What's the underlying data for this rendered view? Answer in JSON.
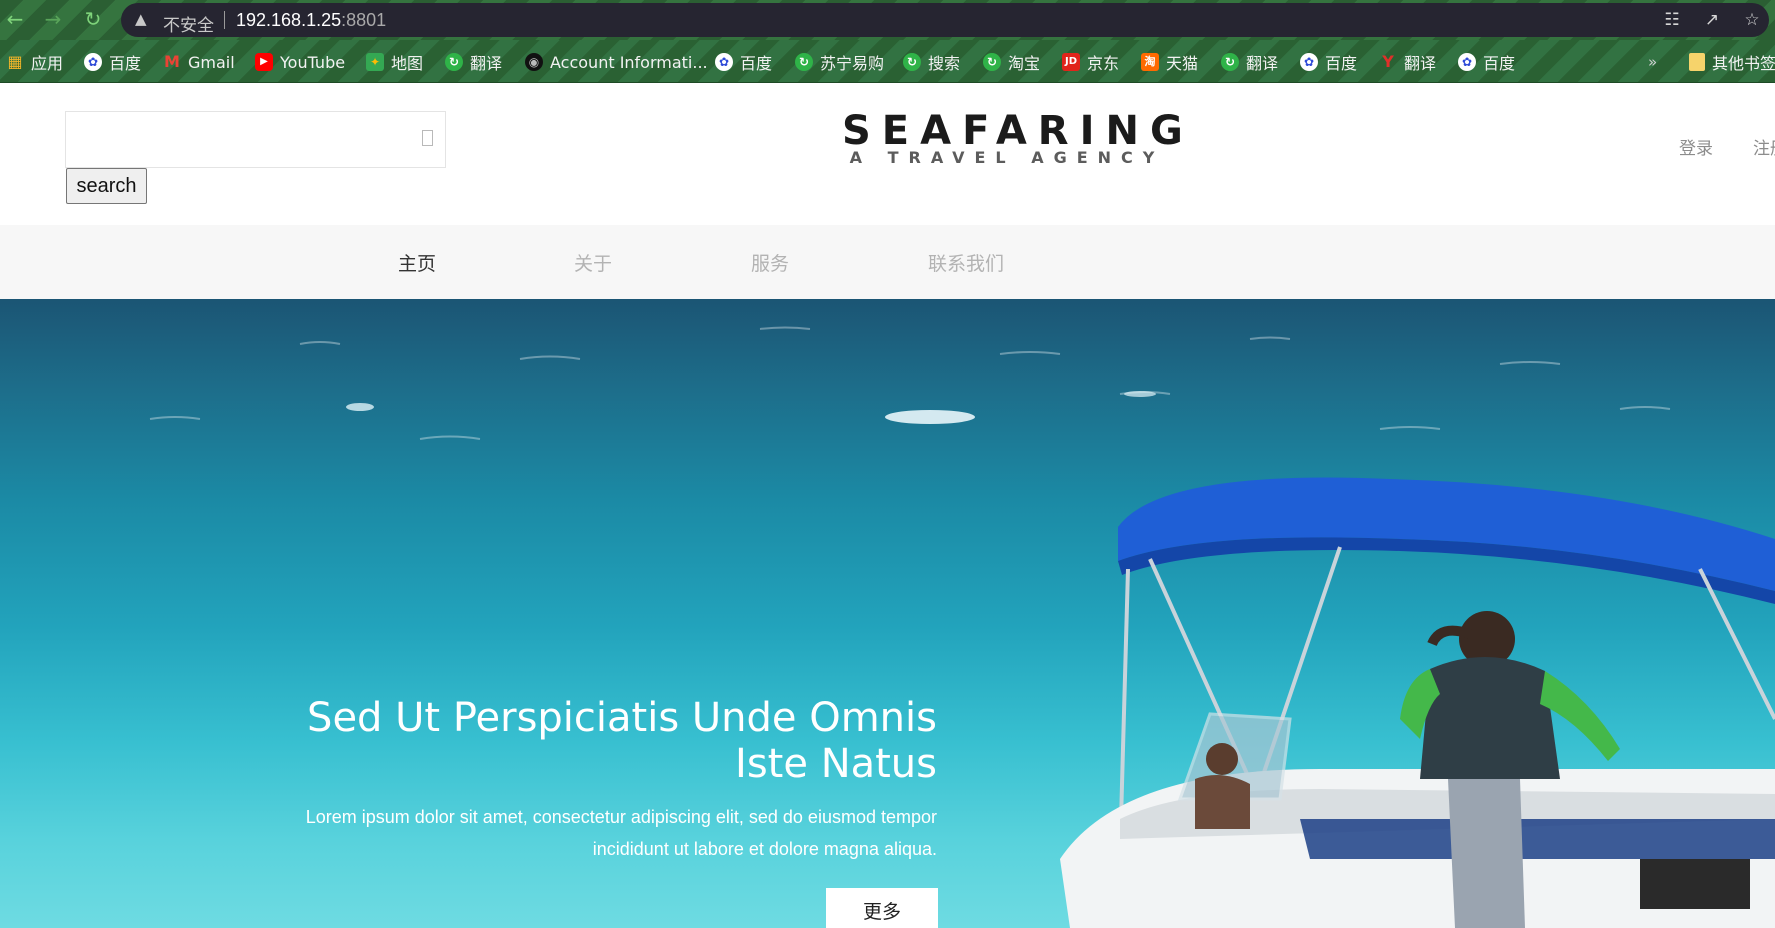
{
  "browser": {
    "security_label": "不安全",
    "url_host": "192.168.1.25",
    "url_port": ":8801",
    "bookmarks": [
      {
        "label": "应用",
        "icon": "apps-grid-icon"
      },
      {
        "label": "百度",
        "icon": "baidu-icon"
      },
      {
        "label": "Gmail",
        "icon": "gmail-icon"
      },
      {
        "label": "YouTube",
        "icon": "youtube-icon"
      },
      {
        "label": "地图",
        "icon": "maps-icon"
      },
      {
        "label": "翻译",
        "icon": "translate-icon"
      },
      {
        "label": "Account Informati...",
        "icon": "account-icon"
      },
      {
        "label": "百度",
        "icon": "baidu-icon"
      },
      {
        "label": "苏宁易购",
        "icon": "suning-icon"
      },
      {
        "label": "搜索",
        "icon": "search-bookmark-icon"
      },
      {
        "label": "淘宝",
        "icon": "taobao-icon"
      },
      {
        "label": "京东",
        "icon": "jd-icon"
      },
      {
        "label": "天猫",
        "icon": "tmall-icon"
      },
      {
        "label": "翻译",
        "icon": "translate-icon"
      },
      {
        "label": "百度",
        "icon": "baidu-icon"
      },
      {
        "label": "翻译",
        "icon": "youdao-icon"
      },
      {
        "label": "百度",
        "icon": "baidu-icon"
      }
    ],
    "more_bookmarks": "»",
    "other_bookmarks": "其他书签"
  },
  "header": {
    "search_placeholder": "",
    "search_button": "search",
    "logo_title": "SEAFARING",
    "logo_subtitle": "A TRAVEL AGENCY",
    "login": "登录",
    "register": "注册"
  },
  "nav": {
    "items": [
      {
        "label": "主页"
      },
      {
        "label": "关于"
      },
      {
        "label": "服务"
      },
      {
        "label": "联系我们"
      }
    ]
  },
  "hero": {
    "title": "Sed Ut Perspiciatis Unde Omnis Iste Natus",
    "text": "Lorem ipsum dolor sit amet, consectetur adipiscing elit, sed do eiusmod tempor incididunt ut labore et dolore magna aliqua.",
    "button": "更多"
  }
}
